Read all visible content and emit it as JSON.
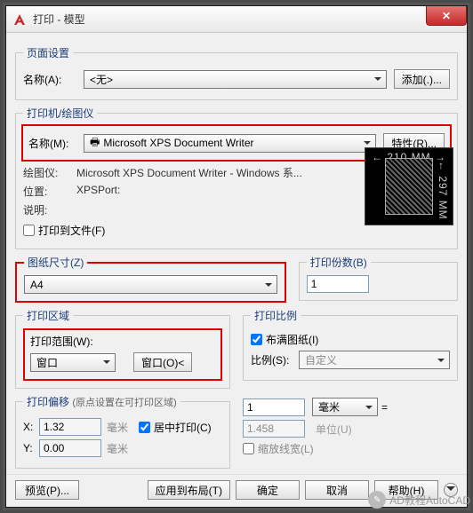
{
  "window": {
    "title": "打印 - 模型",
    "close": "✕"
  },
  "pageSetup": {
    "legend": "页面设置",
    "name_label": "名称(A):",
    "name_value": "<无>",
    "add_btn": "添加(.)..."
  },
  "plotter": {
    "legend": "打印机/绘图仪",
    "name_label": "名称(M):",
    "name_value": "Microsoft XPS Document Writer",
    "props_btn": "特性(R)...",
    "device_label": "绘图仪:",
    "device_value": "Microsoft XPS Document Writer - Windows 系...",
    "location_label": "位置:",
    "location_value": "XPSPort:",
    "desc_label": "说明:",
    "desc_value": "",
    "to_file_label": "打印到文件(F)",
    "preview_top": "← 210 MM →",
    "preview_right": "← 297 MM →"
  },
  "paper": {
    "legend": "图纸尺寸(Z)",
    "value": "A4",
    "copies_legend": "打印份数(B)",
    "copies_value": "1"
  },
  "area": {
    "legend": "打印区域",
    "range_label": "打印范围(W):",
    "range_value": "窗口",
    "window_btn": "窗口(O)<"
  },
  "scale": {
    "legend": "打印比例",
    "fit_label": "布满图纸(I)",
    "ratio_label": "比例(S):",
    "ratio_value": "自定义",
    "top_value": "1",
    "top_unit": "毫米",
    "bot_value": "1.458",
    "bot_unit_label": "单位(U)",
    "lw_label": "缩放线宽(L)"
  },
  "offset": {
    "legend_main": "打印偏移",
    "legend_note": "(原点设置在可打印区域)",
    "x_label": "X:",
    "x_value": "1.32",
    "y_label": "Y:",
    "y_value": "0.00",
    "unit": "毫米",
    "center_label": "居中打印(C)"
  },
  "footer": {
    "preview": "预览(P)...",
    "apply": "应用到布局(T)",
    "ok": "确定",
    "cancel": "取消",
    "help": "帮助(H)"
  },
  "watermark": "AD教程AutoCAD"
}
